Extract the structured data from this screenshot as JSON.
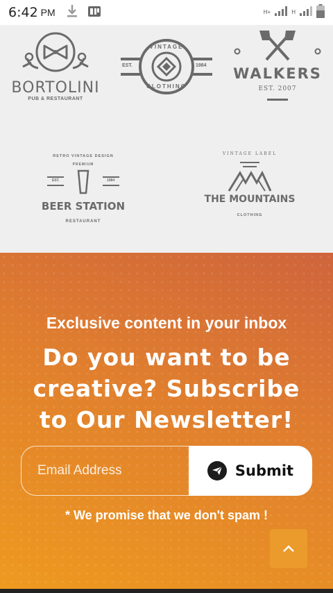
{
  "status_bar": {
    "time": "6:42",
    "ampm": "PM",
    "network_label_1": "H+",
    "network_label_2": "H",
    "icons": [
      "download-icon",
      "notification-app-icon",
      "signal-icon",
      "signal-icon",
      "battery-icon"
    ]
  },
  "logos": {
    "bortolini": {
      "name": "BORTOLINI",
      "sub": "PUB & RESTAURANT"
    },
    "vintage": {
      "top": "VINTAGE",
      "bottom": "CLOTHING",
      "left": "EST.",
      "right": "1984"
    },
    "walkers": {
      "name": "WALKERS",
      "sub": "EST. 2007"
    },
    "beer_station": {
      "arc": "RETRO VINTAGE DESIGN",
      "premium": "PREMIUM",
      "est": "EST.",
      "year": "1984",
      "name": "BEER STATION",
      "sub": "RESTAURANT"
    },
    "mountains": {
      "arc": "VINTAGE LABEL",
      "name": "THE MOUNTAINS",
      "sub": "CLOTHING"
    }
  },
  "newsletter": {
    "kicker": "Exclusive content in your inbox",
    "title": "Do you want to be creative? Subscribe to Our Newsletter!",
    "email_placeholder": "Email Address",
    "submit_label": "Submit",
    "note": "* We promise that we don't spam !"
  },
  "colors": {
    "gradient_top": "#cf643c",
    "gradient_bottom": "#ee9a1f",
    "logo_gray": "#6a6a6a",
    "back_to_top": "#eb9a2c"
  }
}
